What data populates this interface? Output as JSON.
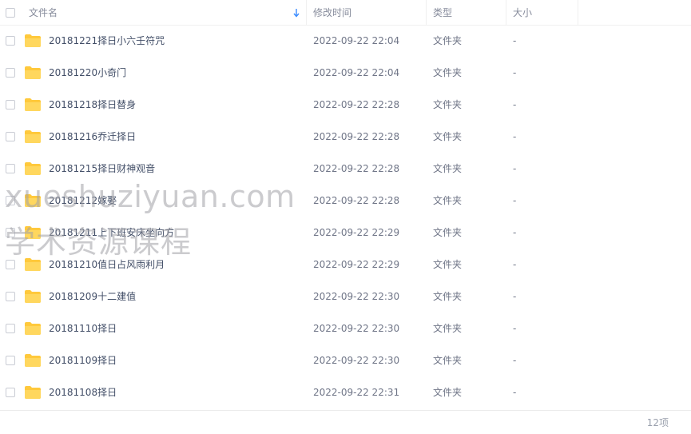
{
  "header": {
    "name_label": "文件名",
    "time_label": "修改时间",
    "type_label": "类型",
    "size_label": "大小"
  },
  "files": [
    {
      "name": "20181221择日小六壬符咒",
      "time": "2022-09-22 22:04",
      "type": "文件夹",
      "size": "-"
    },
    {
      "name": "20181220小奇门",
      "time": "2022-09-22 22:04",
      "type": "文件夹",
      "size": "-"
    },
    {
      "name": "20181218择日替身",
      "time": "2022-09-22 22:28",
      "type": "文件夹",
      "size": "-"
    },
    {
      "name": "20181216乔迁择日",
      "time": "2022-09-22 22:28",
      "type": "文件夹",
      "size": "-"
    },
    {
      "name": "20181215择日财神观音",
      "time": "2022-09-22 22:28",
      "type": "文件夹",
      "size": "-"
    },
    {
      "name": "20181212嫁娶",
      "time": "2022-09-22 22:28",
      "type": "文件夹",
      "size": "-"
    },
    {
      "name": "20181211上下班安床坐向方",
      "time": "2022-09-22 22:29",
      "type": "文件夹",
      "size": "-"
    },
    {
      "name": "20181210值日占风雨利月",
      "time": "2022-09-22 22:29",
      "type": "文件夹",
      "size": "-"
    },
    {
      "name": "20181209十二建值",
      "time": "2022-09-22 22:30",
      "type": "文件夹",
      "size": "-"
    },
    {
      "name": "20181110择日",
      "time": "2022-09-22 22:30",
      "type": "文件夹",
      "size": "-"
    },
    {
      "name": "20181109择日",
      "time": "2022-09-22 22:30",
      "type": "文件夹",
      "size": "-"
    },
    {
      "name": "20181108择日",
      "time": "2022-09-22 22:31",
      "type": "文件夹",
      "size": "-"
    }
  ],
  "footer": {
    "count_label": "12项"
  },
  "watermark": {
    "line1": "xueshuziyuan.com",
    "line2": "学术资源课程"
  },
  "colors": {
    "folder": "#ffc93c",
    "sort_arrow": "#3b8cff"
  },
  "icons": {
    "folder": "folder-icon",
    "sort": "sort-down-icon",
    "checkbox": "checkbox-icon"
  }
}
